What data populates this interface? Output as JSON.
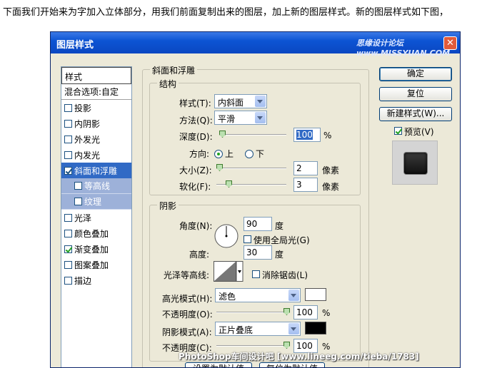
{
  "intro_text": "下面我们开始来为字加入立体部分，用我们前面复制出来的图层，加上新的图层样式。新的图层样式如下图，",
  "dialog": {
    "title": "图层样式",
    "watermark": "思缘设计论坛 www.MISSYUAN.COM",
    "close_glyph": "✕"
  },
  "styles_panel": {
    "header": "样式",
    "blend_options": "混合选项:自定",
    "items": [
      {
        "label": "投影",
        "checked": false
      },
      {
        "label": "内阴影",
        "checked": false
      },
      {
        "label": "外发光",
        "checked": false
      },
      {
        "label": "内发光",
        "checked": false
      },
      {
        "label": "斜面和浮雕",
        "checked": true,
        "selected": true
      },
      {
        "label": "等高线",
        "checked": false,
        "sub": true
      },
      {
        "label": "纹理",
        "checked": false,
        "sub": true
      },
      {
        "label": "光泽",
        "checked": false
      },
      {
        "label": "颜色叠加",
        "checked": false
      },
      {
        "label": "渐变叠加",
        "checked": true
      },
      {
        "label": "图案叠加",
        "checked": false
      },
      {
        "label": "描边",
        "checked": false
      }
    ]
  },
  "bevel": {
    "section_title": "斜面和浮雕",
    "structure_title": "结构",
    "style_label": "样式(T):",
    "style_value": "内斜面",
    "technique_label": "方法(Q):",
    "technique_value": "平滑",
    "depth_label": "深度(D):",
    "depth_value": "100",
    "depth_unit": "%",
    "depth_level": 0.0,
    "direction_label": "方向:",
    "dir_up": "上",
    "dir_down": "下",
    "size_label": "大小(Z):",
    "size_value": "2",
    "size_unit": "像素",
    "soften_label": "软化(F):",
    "soften_value": "3",
    "soften_unit": "像素"
  },
  "shading": {
    "title": "阴影",
    "angle_label": "角度(N):",
    "angle_value": "90",
    "angle_unit": "度",
    "global_light_label": "使用全局光(G)",
    "global_light_checked": false,
    "altitude_label": "高度:",
    "altitude_value": "30",
    "altitude_unit": "度",
    "gloss_label": "光泽等高线:",
    "antialias_label": "消除锯齿(L)",
    "highlight_mode_label": "高光模式(H):",
    "highlight_mode_value": "滤色",
    "highlight_color": "#ffffff",
    "highlight_opacity_label": "不透明度(O):",
    "highlight_opacity_value": "100",
    "shadow_mode_label": "阴影模式(A):",
    "shadow_mode_value": "正片叠底",
    "shadow_color": "#000000",
    "shadow_opacity_label": "不透明度(C):",
    "shadow_opacity_value": "100",
    "pct": "%",
    "set_default": "设置为默认值",
    "reset_default": "复位为默认值"
  },
  "buttons": {
    "ok": "确定",
    "reset": "复位",
    "new_style": "新建样式(W)...",
    "preview": "预览(V)"
  },
  "bottom_watermark": "PhotoShop车间设计吧 [www.lineeg.com/tieba/1783]"
}
